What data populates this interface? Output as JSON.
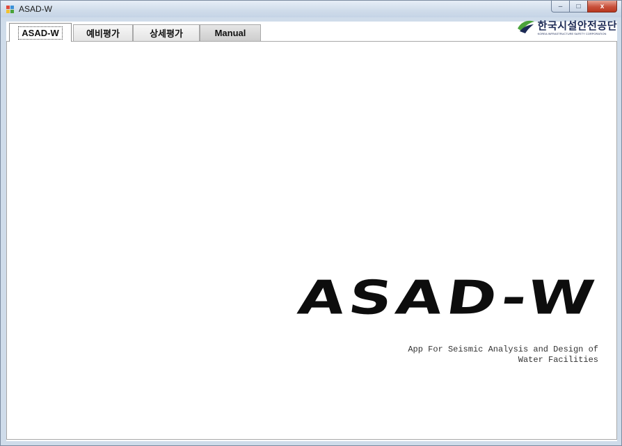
{
  "window": {
    "title": "ASAD-W",
    "controls": {
      "minimize": "‒",
      "maximize": "□",
      "close": "x"
    }
  },
  "tabs": [
    {
      "label": "ASAD-W",
      "active": true
    },
    {
      "label": "예비평가",
      "active": false
    },
    {
      "label": "상세평가",
      "active": false
    },
    {
      "label": "Manual",
      "active": false
    }
  ],
  "logo": {
    "main": "한국시설안전공단",
    "sub": "KOREA INFRASTRUCTURE SAFETY CORPORATION",
    "icon": "kistec-logo-icon"
  },
  "main": {
    "app_title": "ASAD-W",
    "subtitle_line1": "App For Seismic Analysis and Design of",
    "subtitle_line2": "Water Facilities"
  },
  "colors": {
    "titlebar": "#cfdcea",
    "close_button": "#c8503b",
    "logo_navy": "#1c2a55",
    "logo_green": "#4aa33a"
  }
}
